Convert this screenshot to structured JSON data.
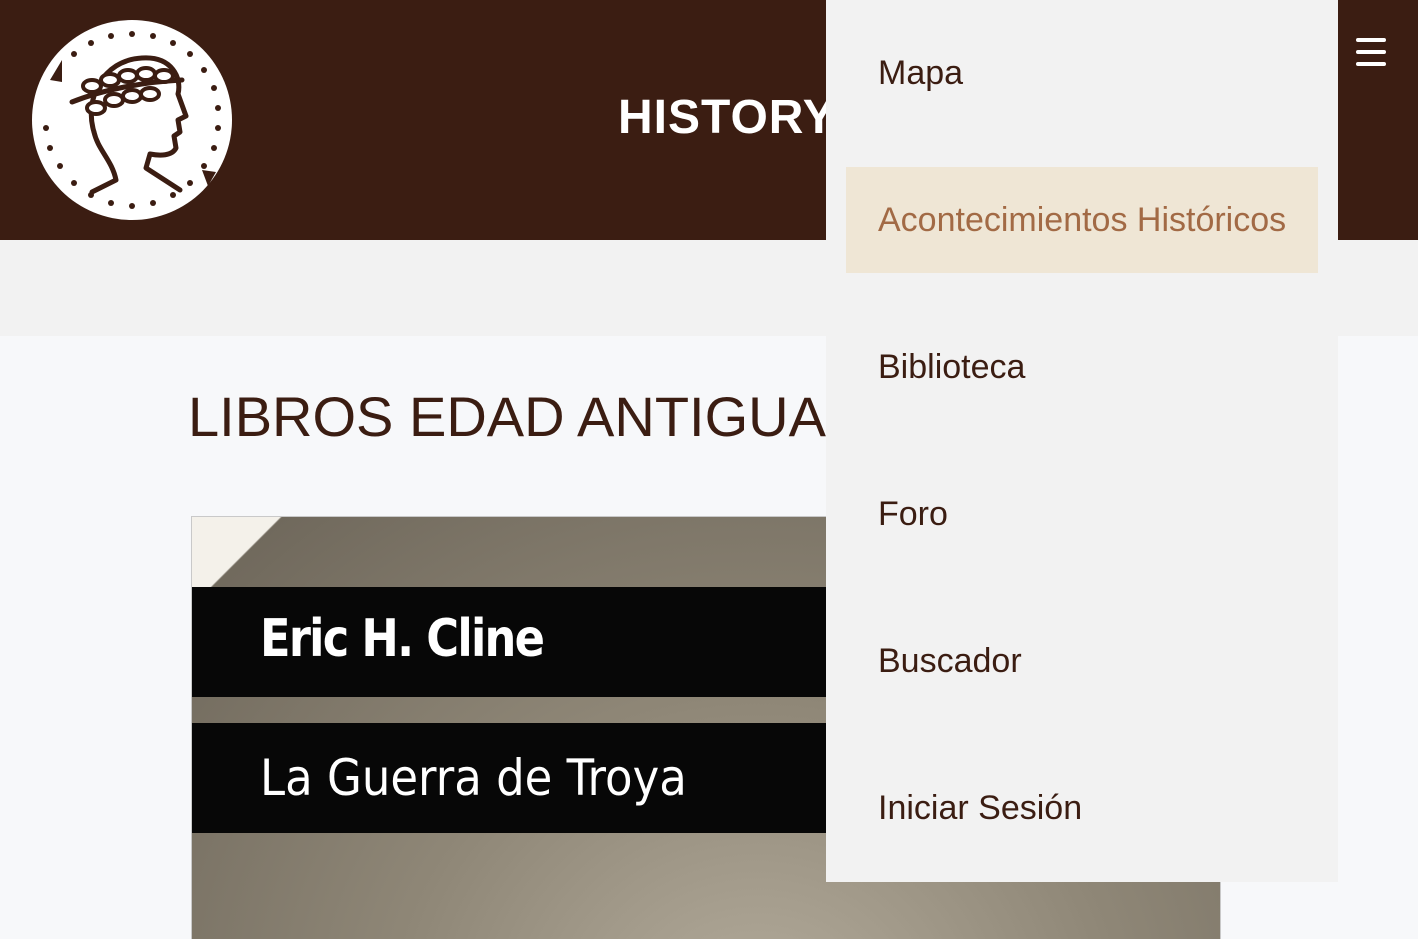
{
  "header": {
    "site_title": "HISTORY",
    "logo_icon": "roman-emperor-coin-icon",
    "menu_icon": "hamburger-menu-icon",
    "background_color": "#3b1d12"
  },
  "main": {
    "section_title": "LIBROS EDAD ANTIGUA",
    "books": [
      {
        "author": "Eric H. Cline",
        "title": "La Guerra de Troya"
      }
    ]
  },
  "nav_menu": {
    "items": [
      {
        "label": "Mapa",
        "active": false
      },
      {
        "label": "Acontecimientos Históricos",
        "active": true
      },
      {
        "label": "Biblioteca",
        "active": false
      },
      {
        "label": "Foro",
        "active": false
      },
      {
        "label": "Buscador",
        "active": false
      },
      {
        "label": "Iniciar Sesión",
        "active": false
      }
    ],
    "active_background": "#efe6d5",
    "active_text_color": "#a26a45",
    "text_color": "#3b1d12"
  }
}
